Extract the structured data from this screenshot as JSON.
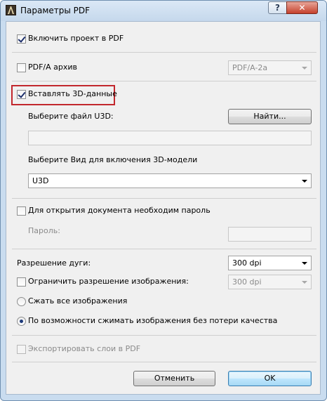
{
  "window": {
    "title": "Параметры PDF",
    "help_label": "?",
    "close_label": "✕"
  },
  "options": {
    "include_project_label": "Включить проект в PDF",
    "pdfa_label": "PDF/A архив",
    "pdfa_value": "PDF/A-2a",
    "insert_3d_label": "Вставлять 3D-данные",
    "choose_u3d_label": "Выберите файл U3D:",
    "find_button_label": "Найти...",
    "u3d_path_value": "",
    "choose_view_label": "Выберите Вид для включения 3D-модели",
    "view_value": "U3D",
    "password_required_label": "Для открытия документа необходим пароль",
    "password_label": "Пароль:",
    "password_value": "",
    "arc_resolution_label": "Разрешение дуги:",
    "arc_resolution_value": "300 dpi",
    "limit_image_res_label": "Ограничить разрешение изображения:",
    "limit_image_res_value": "300 dpi",
    "compress_all_label": "Сжать все изображения",
    "lossless_label": "По возможности сжимать изображения без потери качества",
    "export_layers_label": "Экспортировать слои в PDF"
  },
  "buttons": {
    "cancel_label": "Отменить",
    "ok_label": "OK"
  },
  "colors": {
    "highlight_border": "#c2272d",
    "title_bar": "#c9dcef"
  }
}
